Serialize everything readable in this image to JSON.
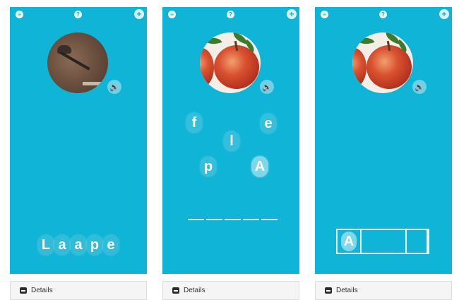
{
  "screens": [
    {
      "name": "scramble",
      "scrambled_letters": [
        "L",
        "a",
        "a",
        "p",
        "e"
      ]
    },
    {
      "name": "pick-letters",
      "floating_letters": [
        "f",
        "l",
        "e",
        "p",
        "A"
      ],
      "blank_count": 5
    },
    {
      "name": "answer",
      "answer_letters": [
        "A"
      ]
    }
  ],
  "icons": {
    "menu": "≡",
    "help": "?",
    "add": "+",
    "speaker": "🔊"
  },
  "footer": {
    "label": "Details"
  }
}
